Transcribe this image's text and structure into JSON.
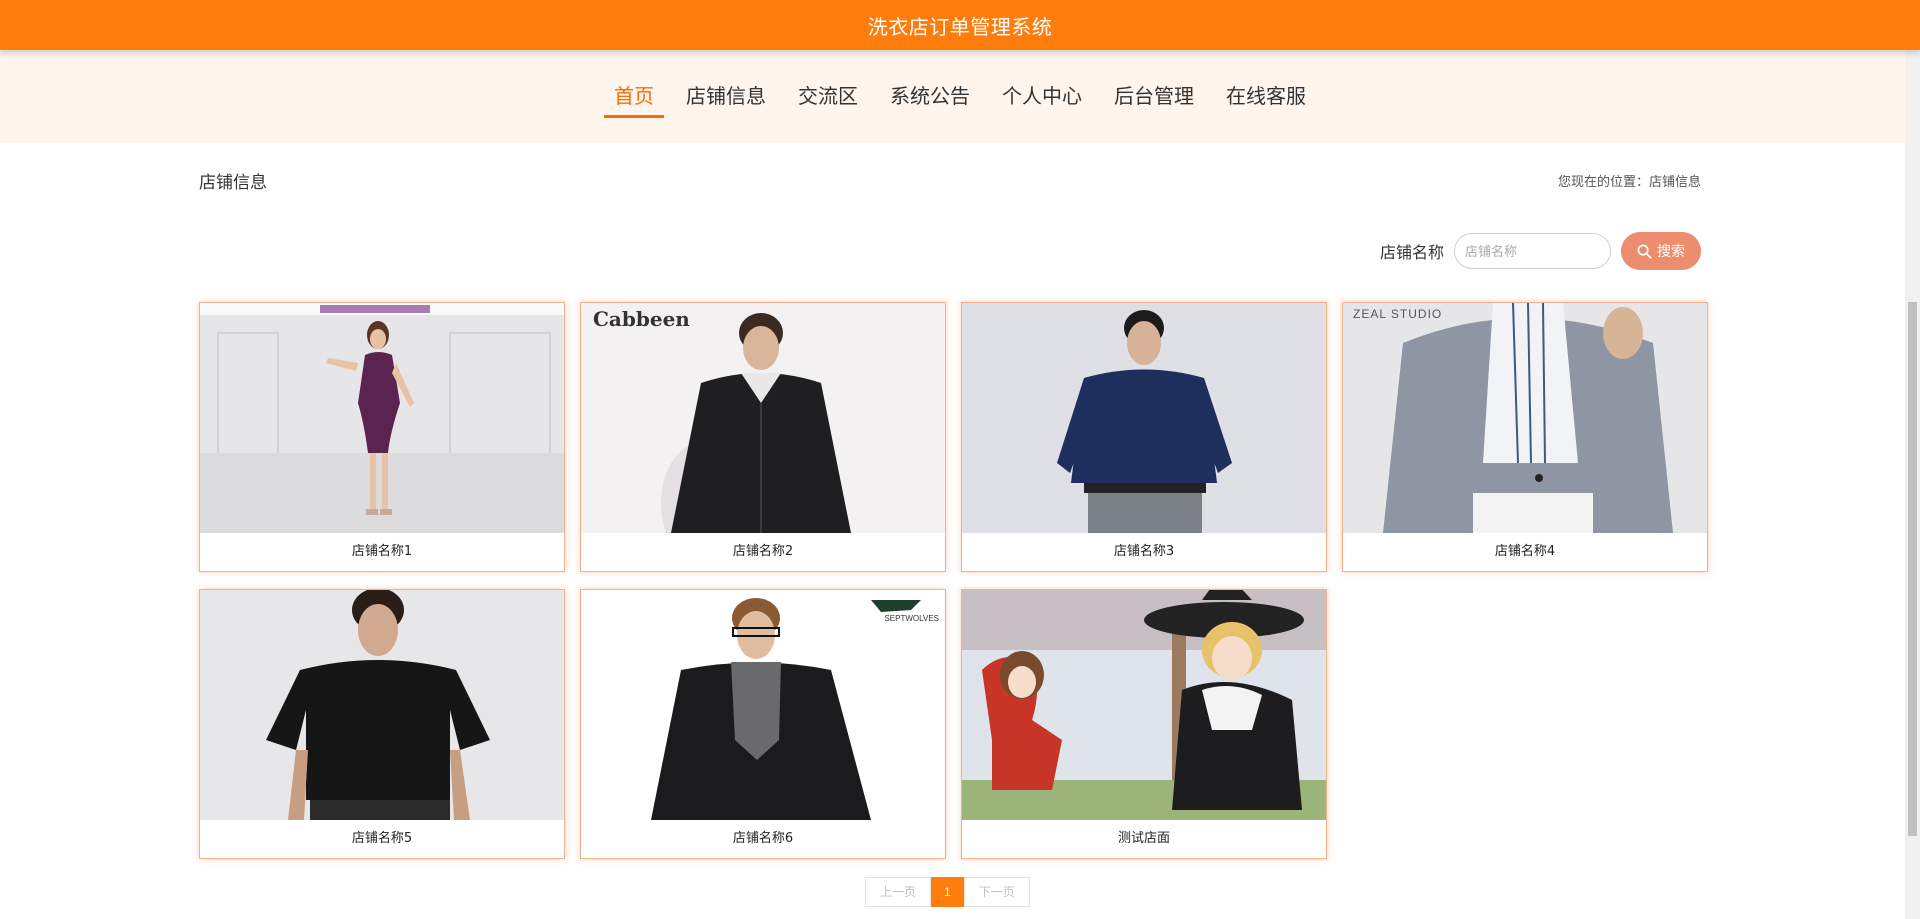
{
  "header": {
    "title": "洗衣店订单管理系统"
  },
  "nav": {
    "items": [
      {
        "label": "首页",
        "active": true
      },
      {
        "label": "店铺信息",
        "active": false
      },
      {
        "label": "交流区",
        "active": false
      },
      {
        "label": "系统公告",
        "active": false
      },
      {
        "label": "个人中心",
        "active": false
      },
      {
        "label": "后台管理",
        "active": false
      },
      {
        "label": "在线客服",
        "active": false
      }
    ]
  },
  "page": {
    "section_title": "店铺信息",
    "breadcrumb": "您现在的位置：店铺信息"
  },
  "search": {
    "label": "店铺名称",
    "placeholder": "店铺名称",
    "value": "",
    "button_label": "搜索"
  },
  "shops": [
    {
      "name": "店铺名称1",
      "image": "woman-purple-dress-photo"
    },
    {
      "name": "店铺名称2",
      "image": "man-black-jacket-photo",
      "brand": "Cabbeen"
    },
    {
      "name": "店铺名称3",
      "image": "man-navy-shirt-photo"
    },
    {
      "name": "店铺名称4",
      "image": "man-grey-blazer-photo",
      "brand": "ZEAL STUDIO"
    },
    {
      "name": "店铺名称5",
      "image": "man-black-tshirt-photo"
    },
    {
      "name": "店铺名称6",
      "image": "man-glasses-scarf-jacket-photo",
      "brand": "SEPTWOLVES"
    },
    {
      "name": "测试店面",
      "image": "anime-girls-illustration"
    }
  ],
  "pagination": {
    "prev_label": "上一页",
    "current_page": "1",
    "next_label": "下一页"
  },
  "colors": {
    "primary": "#ff7d0c",
    "nav_band": "#fff5ed",
    "search_button": "#ec8d6f",
    "card_border": "#f5b08c"
  }
}
